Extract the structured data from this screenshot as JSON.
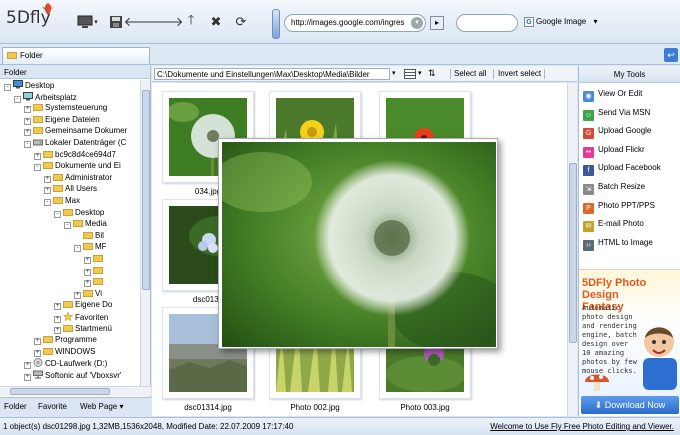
{
  "app": {
    "logo_text": "5Dfly"
  },
  "toolbar": {
    "url_value": "http://images.google.com/ingres",
    "search_value": "",
    "search_engine_label": "Google Image"
  },
  "folder_tab": {
    "label": "Folder"
  },
  "left_panel": {
    "header": "Folder",
    "tree": [
      {
        "label": "Desktop",
        "depth": 0,
        "toggle": "-",
        "icon": "desktop"
      },
      {
        "label": "Arbeitsplatz",
        "depth": 1,
        "toggle": "-",
        "icon": "computer"
      },
      {
        "label": "Systemsteuerung",
        "depth": 2,
        "toggle": "+",
        "icon": "folder"
      },
      {
        "label": "Eigene Dateien",
        "depth": 2,
        "toggle": "+",
        "icon": "folder"
      },
      {
        "label": "Gemeinsame Dokumer",
        "depth": 2,
        "toggle": "+",
        "icon": "folder"
      },
      {
        "label": "Lokaler Datenträger (C",
        "depth": 2,
        "toggle": "-",
        "icon": "drive"
      },
      {
        "label": "bc9c8d4ce694d7",
        "depth": 3,
        "toggle": "+",
        "icon": "folder"
      },
      {
        "label": "Dokumente und Ei",
        "depth": 3,
        "toggle": "-",
        "icon": "folder"
      },
      {
        "label": "Administrator",
        "depth": 4,
        "toggle": "+",
        "icon": "folder"
      },
      {
        "label": "All Users",
        "depth": 4,
        "toggle": "+",
        "icon": "folder"
      },
      {
        "label": "Max",
        "depth": 4,
        "toggle": "-",
        "icon": "folder"
      },
      {
        "label": "Desktop",
        "depth": 5,
        "toggle": "-",
        "icon": "folder"
      },
      {
        "label": "Media",
        "depth": 6,
        "toggle": "-",
        "icon": "folder"
      },
      {
        "label": "Bil",
        "depth": 7,
        "toggle": "",
        "icon": "folder"
      },
      {
        "label": "MF",
        "depth": 7,
        "toggle": "-",
        "icon": "folder"
      },
      {
        "label": "",
        "depth": 8,
        "toggle": "+",
        "icon": "folder"
      },
      {
        "label": "",
        "depth": 8,
        "toggle": "+",
        "icon": "folder"
      },
      {
        "label": "",
        "depth": 8,
        "toggle": "+",
        "icon": "folder"
      },
      {
        "label": "Vi",
        "depth": 7,
        "toggle": "+",
        "icon": "folder"
      },
      {
        "label": "Eigene Do",
        "depth": 5,
        "toggle": "+",
        "icon": "folder"
      },
      {
        "label": "Favoriten",
        "depth": 5,
        "toggle": "+",
        "icon": "star"
      },
      {
        "label": "Startmenü",
        "depth": 5,
        "toggle": "+",
        "icon": "folder"
      },
      {
        "label": "Programme",
        "depth": 3,
        "toggle": "+",
        "icon": "folder"
      },
      {
        "label": "WINDOWS",
        "depth": 3,
        "toggle": "+",
        "icon": "folder"
      },
      {
        "label": "CD-Laufwerk (D:)",
        "depth": 2,
        "toggle": "+",
        "icon": "cd"
      },
      {
        "label": "Softonic auf 'Vboxsvr'",
        "depth": 2,
        "toggle": "+",
        "icon": "netdrive"
      }
    ],
    "tabs": [
      "Folder",
      "Favorite",
      "Web Page"
    ]
  },
  "pathbar": {
    "path": "C:\\Dokumente und Einstellungen\\Max\\Desktop\\Media\\Bilder",
    "select_all": "Select all",
    "invert_select": "Invert select"
  },
  "thumbnails": [
    {
      "caption": "034.jpg",
      "scene": "dandelion"
    },
    {
      "caption": "",
      "scene": "yellow-flower"
    },
    {
      "caption": "",
      "scene": "red-flower"
    },
    {
      "caption": "dsc0130",
      "scene": "blue-flower"
    },
    {
      "caption": "",
      "scene": "hidden"
    },
    {
      "caption": "",
      "scene": "hidden"
    },
    {
      "caption": "dsc01314.jpg",
      "scene": "landscape"
    },
    {
      "caption": "Photo 002.jpg",
      "scene": "grass"
    },
    {
      "caption": "Photo 003.jpg",
      "scene": "thistle"
    }
  ],
  "right_panel": {
    "header": "My Tools",
    "tools": [
      {
        "label": "View Or Edit",
        "icon": "view-icon",
        "color": "#4a8cd6"
      },
      {
        "label": "Send Via MSN",
        "icon": "msn-icon",
        "color": "#3aa84a"
      },
      {
        "label": "Upload Google",
        "icon": "google-icon",
        "color": "#d94a3a"
      },
      {
        "label": "Upload Flickr",
        "icon": "flickr-icon",
        "color": "#e03c9a"
      },
      {
        "label": "Upload Facebook",
        "icon": "facebook-icon",
        "color": "#3b5998"
      },
      {
        "label": "Batch Resize",
        "icon": "resize-icon",
        "color": "#8a8a8a"
      },
      {
        "label": "Photo PPT/PPS",
        "icon": "ppt-icon",
        "color": "#d86a2a"
      },
      {
        "label": "E-mail Photo",
        "icon": "email-icon",
        "color": "#c8a02a"
      },
      {
        "label": "HTML to Image",
        "icon": "html-icon",
        "color": "#5a6a7a"
      }
    ],
    "ad": {
      "title": "5DFly Photo Design Fantasy",
      "body": "Automatic photo design and rendering engine, batch design over 10 amazing photos by few mouse clicks."
    },
    "download_label": "Download Now"
  },
  "status": {
    "left": "1 object(s)   dsc01298.jpg   1,32MB,1536x2048, Modified Date: 22.07.2009 17:17:40",
    "right": "Welcome to Use Fly Free Photo Editing and Viewer."
  }
}
